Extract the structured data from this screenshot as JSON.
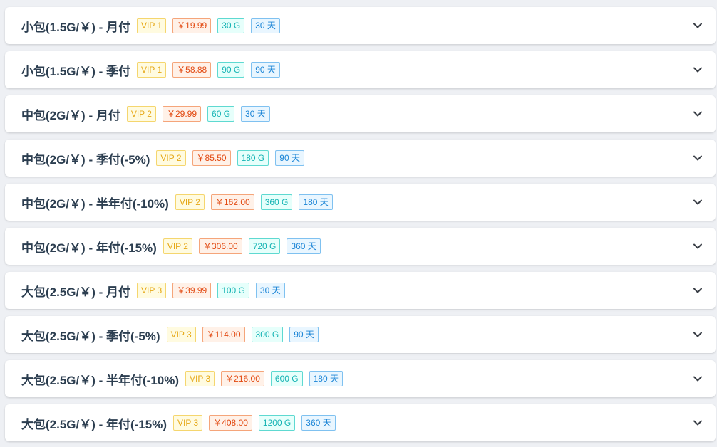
{
  "colors": {
    "page_background": "#eef0f4",
    "card_background": "#ffffff",
    "title_text": "#2c3e50",
    "vip_tag": "#e6a817",
    "price_tag": "#e24a12",
    "size_tag": "#13b3b3",
    "days_tag": "#1a84d6"
  },
  "plans": [
    {
      "title": "小包(1.5G/￥) - 月付",
      "vip": "VIP 1",
      "price": "￥19.99",
      "data": "30 G",
      "days": "30 天",
      "icon": "chevron-down-icon"
    },
    {
      "title": "小包(1.5G/￥) - 季付",
      "vip": "VIP 1",
      "price": "￥58.88",
      "data": "90 G",
      "days": "90 天",
      "icon": "chevron-down-icon"
    },
    {
      "title": "中包(2G/￥) - 月付",
      "vip": "VIP 2",
      "price": "￥29.99",
      "data": "60 G",
      "days": "30 天",
      "icon": "chevron-down-icon"
    },
    {
      "title": "中包(2G/￥) - 季付(-5%)",
      "vip": "VIP 2",
      "price": "￥85.50",
      "data": "180 G",
      "days": "90 天",
      "icon": "chevron-down-icon"
    },
    {
      "title": "中包(2G/￥) - 半年付(-10%)",
      "vip": "VIP 2",
      "price": "￥162.00",
      "data": "360 G",
      "days": "180 天",
      "icon": "chevron-down-icon"
    },
    {
      "title": "中包(2G/￥) - 年付(-15%)",
      "vip": "VIP 2",
      "price": "￥306.00",
      "data": "720 G",
      "days": "360 天",
      "icon": "chevron-down-icon"
    },
    {
      "title": "大包(2.5G/￥) - 月付",
      "vip": "VIP 3",
      "price": "￥39.99",
      "data": "100 G",
      "days": "30 天",
      "icon": "chevron-down-icon"
    },
    {
      "title": "大包(2.5G/￥) - 季付(-5%)",
      "vip": "VIP 3",
      "price": "￥114.00",
      "data": "300 G",
      "days": "90 天",
      "icon": "chevron-down-icon"
    },
    {
      "title": "大包(2.5G/￥) - 半年付(-10%)",
      "vip": "VIP 3",
      "price": "￥216.00",
      "data": "600 G",
      "days": "180 天",
      "icon": "chevron-down-icon"
    },
    {
      "title": "大包(2.5G/￥) - 年付(-15%)",
      "vip": "VIP 3",
      "price": "￥408.00",
      "data": "1200 G",
      "days": "360 天",
      "icon": "chevron-down-icon"
    }
  ]
}
